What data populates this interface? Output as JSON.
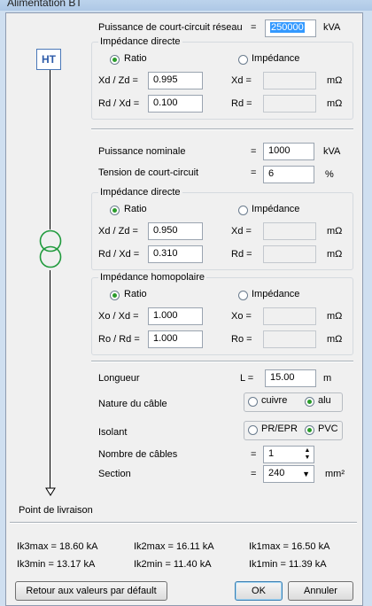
{
  "window": {
    "title": "Alimentation BT"
  },
  "diagram": {
    "ht_label": "HT",
    "delivery_point": "Point de livraison"
  },
  "network": {
    "scc_label": "Puissance de court-circuit réseau",
    "scc_eq": "=",
    "scc_value": "250000",
    "scc_unit": "kVA",
    "group_title": "Impédance directe",
    "radio_ratio": "Ratio",
    "radio_impedance": "Impédance",
    "xd_zd_label": "Xd / Zd =",
    "xd_zd_value": "0.995",
    "xd_label": "Xd =",
    "xd_value": "",
    "xd_unit": "mΩ",
    "rd_xd_label": "Rd / Xd =",
    "rd_xd_value": "0.100",
    "rd_label": "Rd =",
    "rd_value": "",
    "rd_unit": "mΩ"
  },
  "transformer": {
    "power_label": "Puissance nominale",
    "power_eq": "=",
    "power_value": "1000",
    "power_unit": "kVA",
    "ucc_label": "Tension de court-circuit",
    "ucc_eq": "=",
    "ucc_value": "6",
    "ucc_unit": "%",
    "direct": {
      "title": "Impédance directe",
      "radio_ratio": "Ratio",
      "radio_impedance": "Impédance",
      "xd_zd_label": "Xd / Zd =",
      "xd_zd_value": "0.950",
      "xd_label": "Xd =",
      "xd_value": "",
      "xd_unit": "mΩ",
      "rd_xd_label": "Rd / Xd =",
      "rd_xd_value": "0.310",
      "rd_label": "Rd =",
      "rd_value": "",
      "rd_unit": "mΩ"
    },
    "homopolar": {
      "title": "Impédance homopolaire",
      "radio_ratio": "Ratio",
      "radio_impedance": "Impédance",
      "xo_xd_label": "Xo / Xd =",
      "xo_xd_value": "1.000",
      "xo_label": "Xo =",
      "xo_value": "",
      "xo_unit": "mΩ",
      "ro_rd_label": "Ro / Rd =",
      "ro_rd_value": "1.000",
      "ro_label": "Ro =",
      "ro_value": "",
      "ro_unit": "mΩ"
    }
  },
  "cable": {
    "length_label": "Longueur",
    "length_eq": "L =",
    "length_value": "15.00",
    "length_unit": "m",
    "nature_label": "Nature du câble",
    "nature_cuivre": "cuivre",
    "nature_alu": "alu",
    "insulation_label": "Isolant",
    "insulation_prepr": "PR/EPR",
    "insulation_pvc": "PVC",
    "count_label": "Nombre de câbles",
    "count_eq": "=",
    "count_value": "1",
    "section_label": "Section",
    "section_eq": "=",
    "section_value": "240",
    "section_unit": "mm²"
  },
  "results": {
    "ik3max": "Ik3max = 18.60 kA",
    "ik2max": "Ik2max = 16.11 kA",
    "ik1max": "Ik1max = 16.50 kA",
    "ik3min": "Ik3min = 13.17 kA",
    "ik2min": "Ik2min = 11.40 kA",
    "ik1min": "Ik1min = 11.39 kA"
  },
  "buttons": {
    "reset": "Retour aux valeurs par défault",
    "ok": "OK",
    "cancel": "Annuler"
  }
}
